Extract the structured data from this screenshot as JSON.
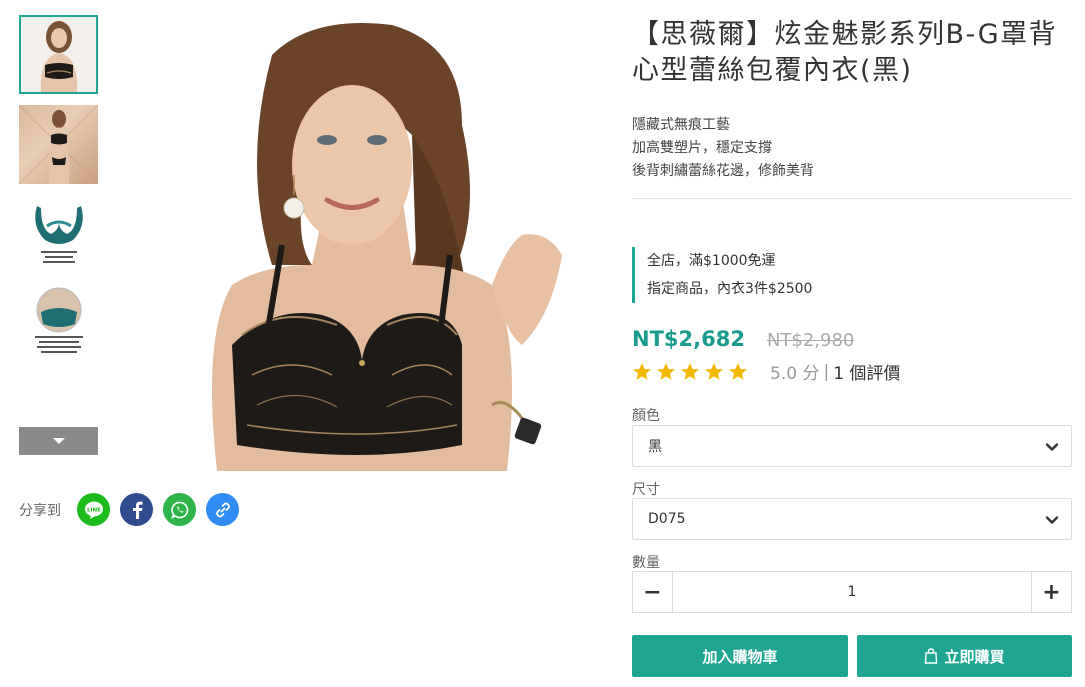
{
  "gallery": {
    "thumbnails": [
      {
        "name": "thumb-front-view",
        "selected": true
      },
      {
        "name": "thumb-full-view",
        "selected": false
      },
      {
        "name": "thumb-teal-product",
        "selected": false
      },
      {
        "name": "thumb-detail-closeup",
        "selected": false
      }
    ],
    "scroll_icon": "caret-down-icon"
  },
  "share": {
    "label": "分享到",
    "buttons": [
      {
        "name": "line",
        "icon": "line-icon",
        "color": "#1dbc1d",
        "text": "LINE"
      },
      {
        "name": "facebook",
        "icon": "facebook-icon",
        "color": "#2f4d8e"
      },
      {
        "name": "whatsapp",
        "icon": "whatsapp-icon",
        "color": "#2fb44a"
      },
      {
        "name": "copy-link",
        "icon": "link-icon",
        "color": "#2f8cf2"
      }
    ]
  },
  "product": {
    "title": "【思薇爾】炫金魅影系列B-G罩背心型蕾絲包覆內衣(黑)",
    "description": [
      "隱藏式無痕工藝",
      "加高雙塑片，穩定支撐",
      "後背刺繡蕾絲花邊，修飾美背"
    ],
    "promotions": [
      "全店，滿$1000免運",
      "指定商品，內衣3件$2500"
    ],
    "price": "NT$2,682",
    "original_price": "NT$2,980",
    "rating": {
      "stars": 5,
      "score_text": "5.0 分",
      "separator": "|",
      "count_text": "1 個評價"
    }
  },
  "options": {
    "color": {
      "label": "顏色",
      "value": "黑"
    },
    "size": {
      "label": "尺寸",
      "value": "D075"
    },
    "quantity": {
      "label": "數量",
      "value": "1",
      "minus": "−",
      "plus": "+"
    }
  },
  "actions": {
    "add_to_cart": "加入購物車",
    "buy_now": "立即購買"
  },
  "colors": {
    "accent": "#1fa693",
    "price": "#1a9b8e",
    "star": "#f5b900"
  }
}
